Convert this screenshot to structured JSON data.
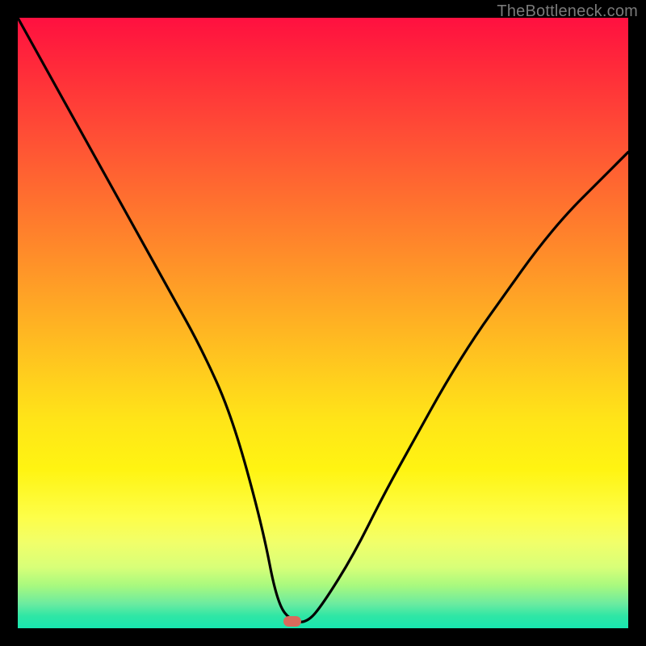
{
  "watermark": "TheBottleneck.com",
  "marker": {
    "x_pct": 45.0,
    "y_pct": 99.0
  },
  "chart_data": {
    "type": "line",
    "title": "",
    "xlabel": "",
    "ylabel": "",
    "xlim": [
      0,
      100
    ],
    "ylim": [
      0,
      100
    ],
    "series": [
      {
        "name": "curve",
        "x": [
          0,
          5,
          10,
          15,
          20,
          25,
          30,
          35,
          40,
          42.5,
          45,
          47.5,
          50,
          55,
          60,
          65,
          70,
          75,
          80,
          85,
          90,
          95,
          100
        ],
        "values": [
          100,
          91,
          82,
          73,
          64,
          55,
          46,
          35,
          17,
          4,
          1,
          1,
          4,
          12,
          22,
          31,
          40,
          48,
          55,
          62,
          68,
          73,
          78
        ]
      }
    ],
    "annotations": [
      {
        "type": "marker",
        "x": 45.0,
        "y": 1.0
      }
    ]
  }
}
